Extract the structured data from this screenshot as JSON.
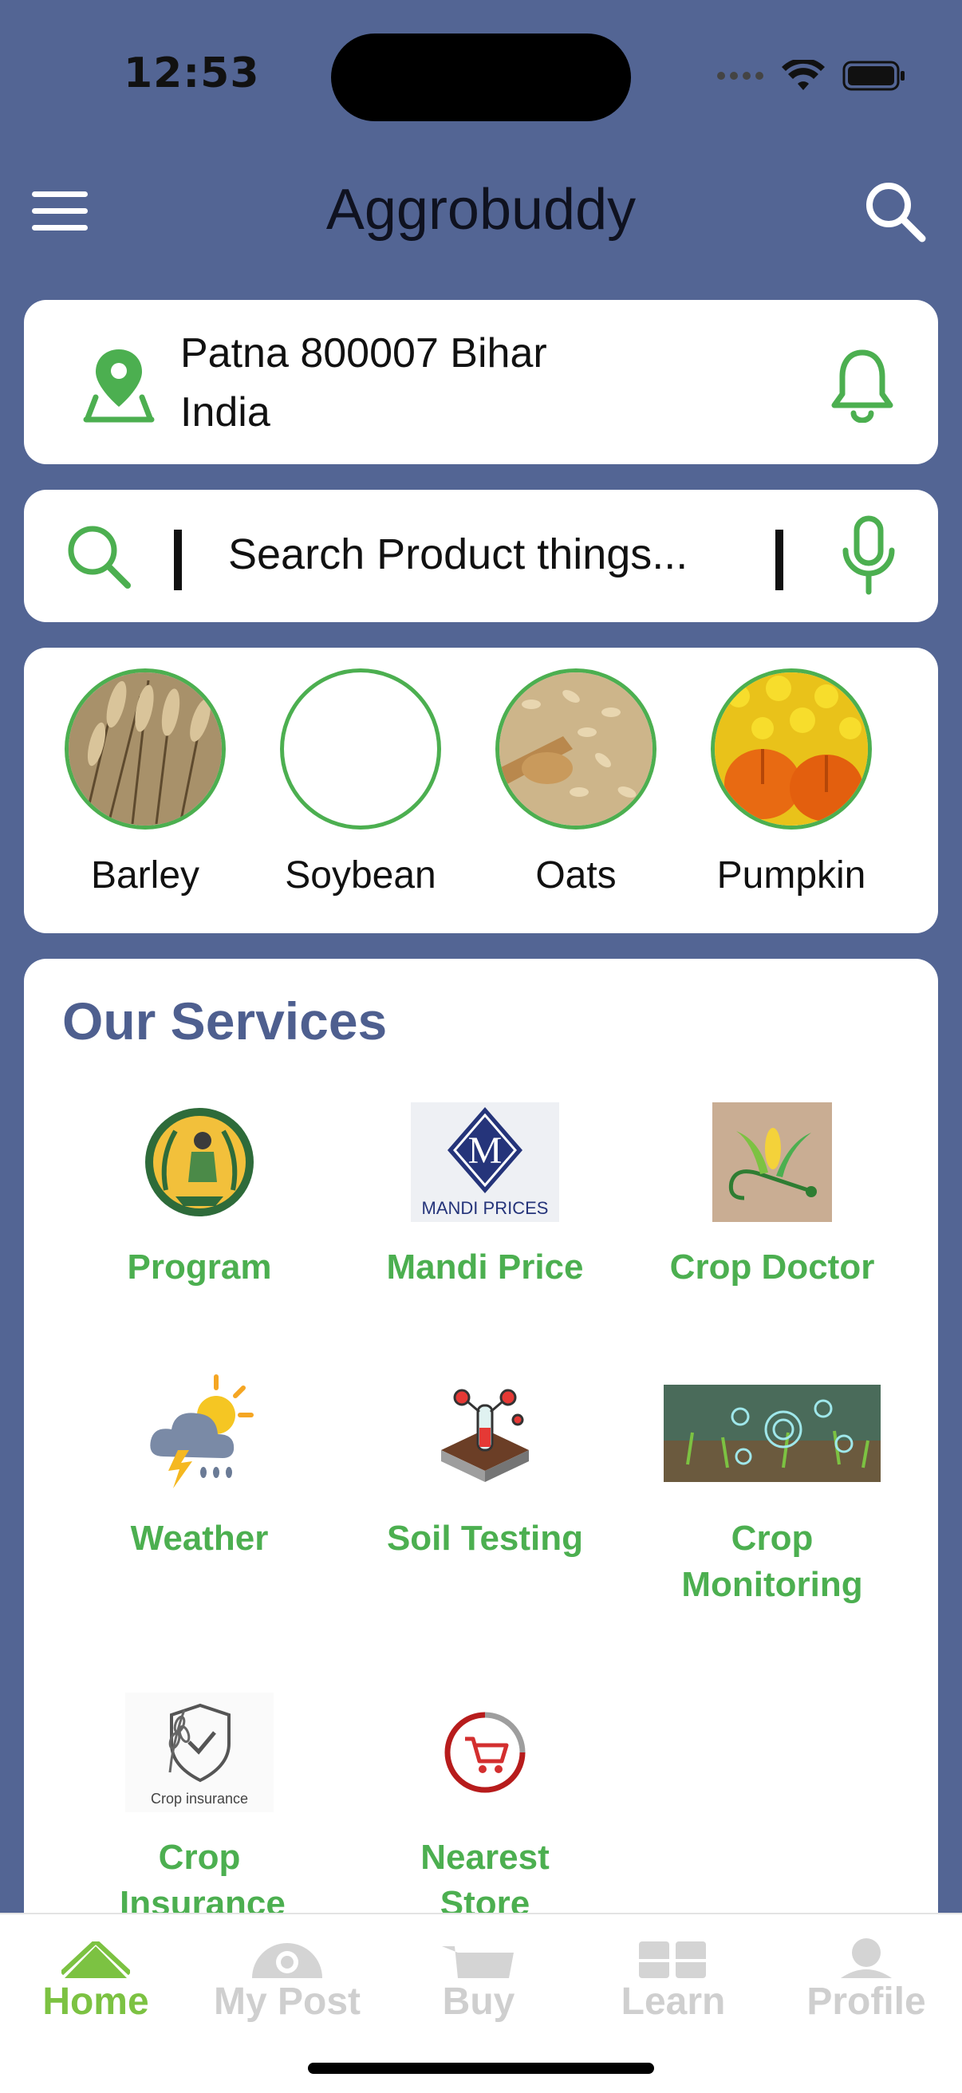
{
  "status": {
    "time": "12:53"
  },
  "header": {
    "title": "Aggrobuddy",
    "menu_icon": "hamburger-menu-icon",
    "search_icon": "search-icon"
  },
  "location": {
    "line1": "Patna 800007 Bihar",
    "line2": "India",
    "pin_icon": "location-pin-icon",
    "bell_icon": "bell-icon"
  },
  "search": {
    "placeholder": "Search Product things...",
    "icon": "search-icon",
    "mic_icon": "microphone-icon"
  },
  "categories": [
    {
      "label": "Barley"
    },
    {
      "label": "Soybean"
    },
    {
      "label": "Oats"
    },
    {
      "label": "Pumpkin"
    }
  ],
  "services": {
    "title": "Our Services",
    "items": [
      {
        "label": "Program"
      },
      {
        "label": "Mandi Price",
        "logo_text": "MANDI PRICES"
      },
      {
        "label": "Crop Doctor"
      },
      {
        "label": "Weather"
      },
      {
        "label": "Soil Testing"
      },
      {
        "label": "Crop Monitoring"
      },
      {
        "label": "Crop Insurance",
        "logo_text": "Crop insurance"
      },
      {
        "label": "Nearest Store"
      }
    ]
  },
  "tabs": [
    {
      "label": "Home",
      "icon": "home-icon",
      "active": true
    },
    {
      "label": "My Post",
      "icon": "post-icon",
      "active": false
    },
    {
      "label": "Buy",
      "icon": "cart-icon",
      "active": false
    },
    {
      "label": "Learn",
      "icon": "learn-icon",
      "active": false
    },
    {
      "label": "Profile",
      "icon": "profile-icon",
      "active": false
    }
  ],
  "colors": {
    "background": "#536594",
    "accent_green": "#4caf50",
    "tab_active": "#7cc242",
    "title_blue": "#4e5f8f"
  }
}
